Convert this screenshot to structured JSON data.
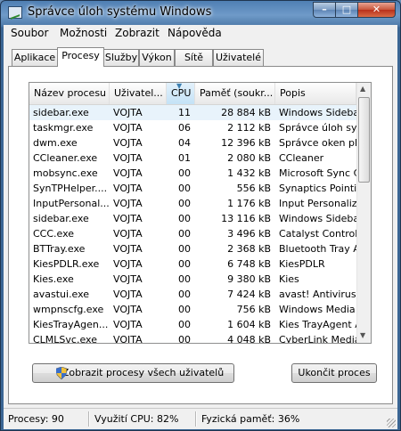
{
  "window": {
    "title": "Správce úloh systému Windows",
    "controls": {
      "minimize": "–",
      "maximize": "□",
      "close": "✕"
    }
  },
  "menu": [
    "Soubor",
    "Možnosti",
    "Zobrazit",
    "Nápověda"
  ],
  "tabs": [
    "Aplikace",
    "Procesy",
    "Služby",
    "Výkon",
    "Sítě",
    "Uživatelé"
  ],
  "active_tab": "Procesy",
  "columns": [
    "Název procesu",
    "Uživatel...",
    "CPU",
    "Paměť (soukr...",
    "Popis"
  ],
  "sorted_column": "CPU",
  "processes": [
    {
      "name": "sidebar.exe",
      "user": "VOJTA",
      "cpu": "11",
      "mem": "28 884 kB",
      "desc": "Windows Sidebar"
    },
    {
      "name": "taskmgr.exe",
      "user": "VOJTA",
      "cpu": "06",
      "mem": "2 112 kB",
      "desc": "Správce úloh systé"
    },
    {
      "name": "dwm.exe",
      "user": "VOJTA",
      "cpu": "04",
      "mem": "12 396 kB",
      "desc": "Správce oken plocl"
    },
    {
      "name": "CCleaner.exe",
      "user": "VOJTA",
      "cpu": "01",
      "mem": "2 080 kB",
      "desc": "CCleaner"
    },
    {
      "name": "mobsync.exe",
      "user": "VOJTA",
      "cpu": "00",
      "mem": "1 432 kB",
      "desc": "Microsoft Sync Cer"
    },
    {
      "name": "SynTPHelper....",
      "user": "VOJTA",
      "cpu": "00",
      "mem": "556 kB",
      "desc": "Synaptics Pointing"
    },
    {
      "name": "InputPersonal...",
      "user": "VOJTA",
      "cpu": "00",
      "mem": "1 176 kB",
      "desc": "Input Personalizati"
    },
    {
      "name": "sidebar.exe",
      "user": "VOJTA",
      "cpu": "00",
      "mem": "13 116 kB",
      "desc": "Windows Sidebar"
    },
    {
      "name": "CCC.exe",
      "user": "VOJTA",
      "cpu": "00",
      "mem": "3 496 kB",
      "desc": "Catalyst Control C"
    },
    {
      "name": "BTTray.exe",
      "user": "VOJTA",
      "cpu": "00",
      "mem": "2 368 kB",
      "desc": "Bluetooth Tray App"
    },
    {
      "name": "KiesPDLR.exe",
      "user": "VOJTA",
      "cpu": "00",
      "mem": "6 748 kB",
      "desc": "KiesPDLR"
    },
    {
      "name": "Kies.exe",
      "user": "VOJTA",
      "cpu": "00",
      "mem": "9 380 kB",
      "desc": "Kies"
    },
    {
      "name": "avastui.exe",
      "user": "VOJTA",
      "cpu": "00",
      "mem": "7 424 kB",
      "desc": "avast! Antivirus"
    },
    {
      "name": "wmpnscfg.exe",
      "user": "VOJTA",
      "cpu": "00",
      "mem": "756 kB",
      "desc": "Windows Media Pla"
    },
    {
      "name": "KiesTrayAgen...",
      "user": "VOJTA",
      "cpu": "00",
      "mem": "1 604 kB",
      "desc": "Kies TrayAgent Ap"
    },
    {
      "name": "CLMLSvc.exe",
      "user": "VOJTA",
      "cpu": "00",
      "mem": "4 048 kB",
      "desc": "CyberLink MediaLib"
    }
  ],
  "selected_row": 0,
  "buttons": {
    "show_all": "Zobrazit procesy všech uživatelů",
    "end_process": "Ukončit proces"
  },
  "status": {
    "processes": "Procesy: 90",
    "cpu": "Využití CPU: 82%",
    "memory": "Fyzická paměť: 36%"
  }
}
